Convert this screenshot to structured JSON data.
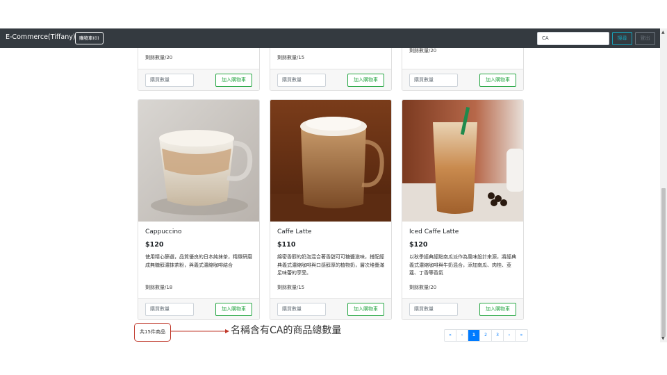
{
  "navbar": {
    "brand": "E-Commerce(Tiffany)",
    "cart_label": "購物車(0)",
    "search_value": "CA",
    "search_label": "搜尋",
    "logout_label": "登出"
  },
  "top_cards": [
    {
      "stock": "剩餘數量/20",
      "qty_placeholder": "購買數量",
      "add_label": "加入購物車"
    },
    {
      "stock": "剩餘數量/15",
      "qty_placeholder": "購買數量",
      "add_label": "加入購物車"
    },
    {
      "stock": "剩餘數量/20",
      "qty_placeholder": "購買數量",
      "add_label": "加入購物車"
    }
  ],
  "products": [
    {
      "name": "Cappuccino",
      "price": "$120",
      "description": "使用精心篩選，品質優良的日本純抹茶，精緻研磨成無糖醇濃抹茶粉，與義式濃縮咖啡結合",
      "stock": "剩餘數量/18",
      "qty_placeholder": "購買數量",
      "add_label": "加入購物車"
    },
    {
      "name": "Caffe Latte",
      "price": "$110",
      "description": "綿密香醇的奶泡混合著香甜可可糖醬滋味，搭配經典義式濃縮咖啡與口感醇厚的植物奶，層次堆疊滿足味蕾的享受。",
      "stock": "剩餘數量/15",
      "qty_placeholder": "購買數量",
      "add_label": "加入購物車"
    },
    {
      "name": "Iced Caffe Latte",
      "price": "$120",
      "description": "以秋季經典經點南瓜派作為風味設計來源，將經典義式濃縮咖啡與牛奶混合，添加南瓜、肉桂、荳蔻、丁香等香氣",
      "stock": "剩餘數量/20",
      "qty_placeholder": "購買數量",
      "add_label": "加入購物車"
    }
  ],
  "footer": {
    "total_label": "共15件商品",
    "annotation": "名稱含有CA的商品總數量"
  },
  "pagination": {
    "first": "«",
    "prev": "‹",
    "pages": [
      "1",
      "2",
      "3"
    ],
    "next": "›",
    "last": "»",
    "active_page": "1"
  },
  "colors": {
    "navbar_bg": "#343a40",
    "add_btn": "#28a745",
    "search_btn": "#17a2b8",
    "page_active": "#007bff",
    "annotation_red": "#c0392b"
  }
}
